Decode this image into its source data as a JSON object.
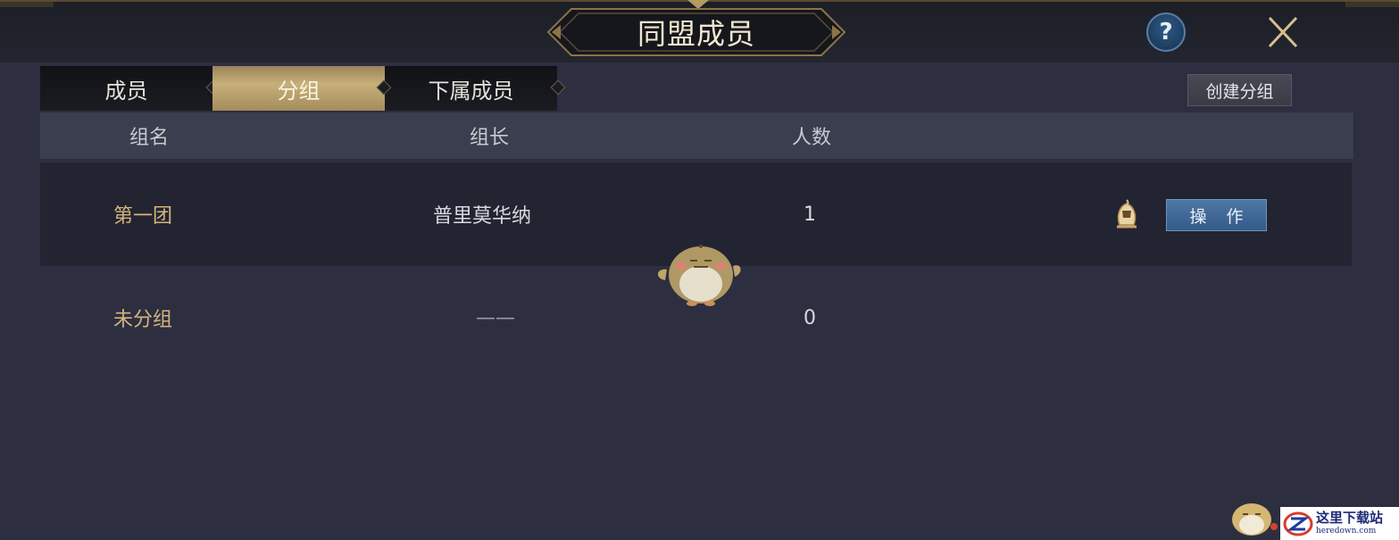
{
  "window": {
    "title": "同盟成员",
    "help_label": "?"
  },
  "tabs": [
    {
      "label": "成员",
      "active": false
    },
    {
      "label": "分组",
      "active": true
    },
    {
      "label": "下属成员",
      "active": false
    }
  ],
  "toolbar": {
    "create_group_label": "创建分组"
  },
  "table": {
    "columns": [
      "组名",
      "组长",
      "人数"
    ],
    "rows": [
      {
        "name": "第一团",
        "leader": "普里莫华纳",
        "count": "1",
        "action_label": "操 作"
      },
      {
        "name": "未分组",
        "leader": "——",
        "count": "0"
      }
    ]
  },
  "watermark": {
    "cn": "这里下载站",
    "en": "heredown.com"
  },
  "colors": {
    "accent_gold": "#d3b57d",
    "active_tab": "#c7b079",
    "action_button": "#4e77a7",
    "background": "#2d2e40"
  }
}
